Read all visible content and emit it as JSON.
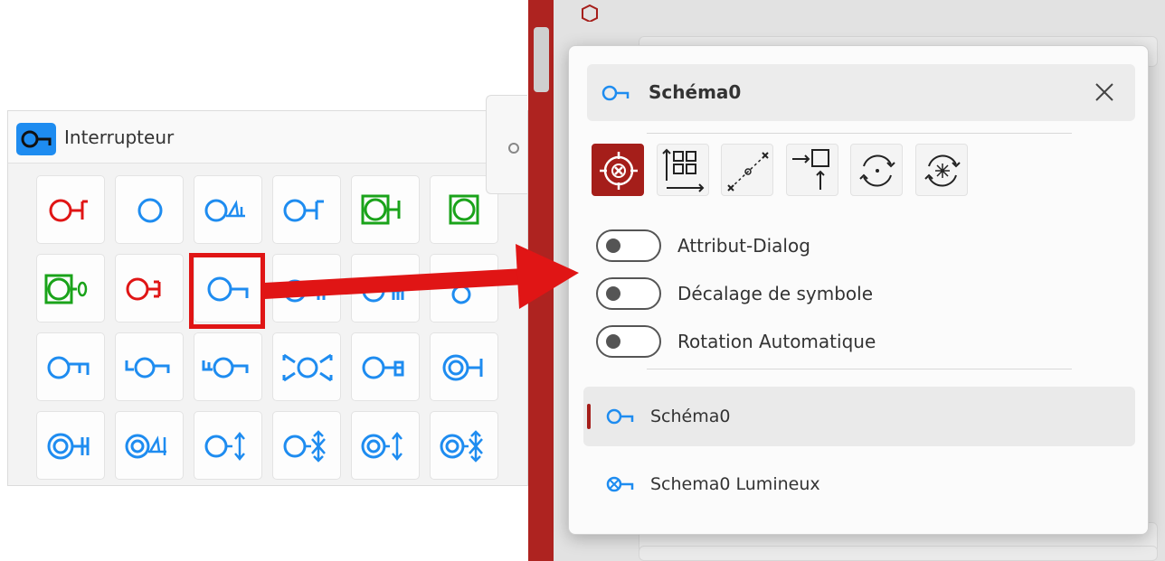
{
  "left_panel": {
    "title": "Interrupteur",
    "icon": "switch-icon",
    "collapse_icon": "chevron-up-icon",
    "grid_rows": 4,
    "grid_columns": 6
  },
  "popup": {
    "title": "Schéma0",
    "title_icon": "switch-symbol-icon",
    "close_icon": "close-icon",
    "toolbar": [
      {
        "name": "target-icon",
        "active": true
      },
      {
        "name": "array-icon",
        "active": false
      },
      {
        "name": "connect-points-icon",
        "active": false
      },
      {
        "name": "move-to-icon",
        "active": false
      },
      {
        "name": "rotate-icon",
        "active": false
      },
      {
        "name": "rotate-light-icon",
        "active": false
      }
    ],
    "toggles": [
      {
        "label": "Attribut-Dialog",
        "on": false
      },
      {
        "label": "Décalage de symbole",
        "on": false
      },
      {
        "label": "Rotation Automatique",
        "on": false
      }
    ],
    "list": [
      {
        "label": "Schéma0",
        "icon": "switch-symbol-icon",
        "selected": true
      },
      {
        "label": "Schema0 Lumineux",
        "icon": "lit-switch-symbol-icon",
        "selected": false
      }
    ]
  },
  "colors": {
    "accent": "#a51e1a",
    "blue": "#1e8cf0",
    "red": "#e01515",
    "green": "#1aa31a"
  }
}
